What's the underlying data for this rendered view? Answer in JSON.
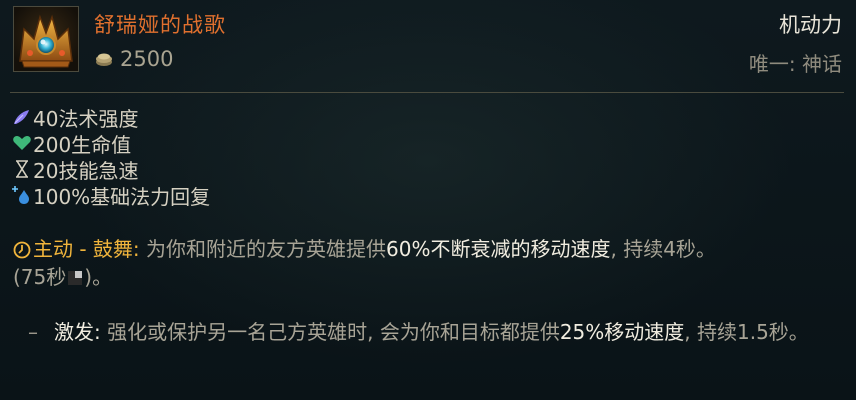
{
  "item": {
    "name": "舒瑞娅的战歌",
    "cost": "2500",
    "category": "机动力",
    "tag": "唯一: 神话"
  },
  "stats": [
    {
      "icon": "ability-power-icon",
      "text": "40法术强度"
    },
    {
      "icon": "health-icon",
      "text": "200生命值"
    },
    {
      "icon": "ability-haste-icon",
      "text": "20技能急速"
    },
    {
      "icon": "mana-regen-icon",
      "text": "100%基础法力回复"
    }
  ],
  "active": {
    "title": "主动 - 鼓舞:",
    "text1": "为你和附近的友方英雄提供",
    "highlight": "60%不断衰减的移动速度",
    "text2": ", 持续4秒。",
    "cooldown_open": "(75秒",
    "cooldown_close": ")。"
  },
  "sub": {
    "dash": "–",
    "label": "激发:",
    "text1": "强化或保护另一名己方英雄时, 会为你和目标都提供",
    "highlight": "25%移动速度",
    "text2": ", 持续1.5秒。"
  },
  "colors": {
    "name": "#e0702e",
    "active_title": "#f0b43c",
    "highlight": "#f1ede0",
    "body": "#a8a496",
    "background": "#0b1419"
  }
}
